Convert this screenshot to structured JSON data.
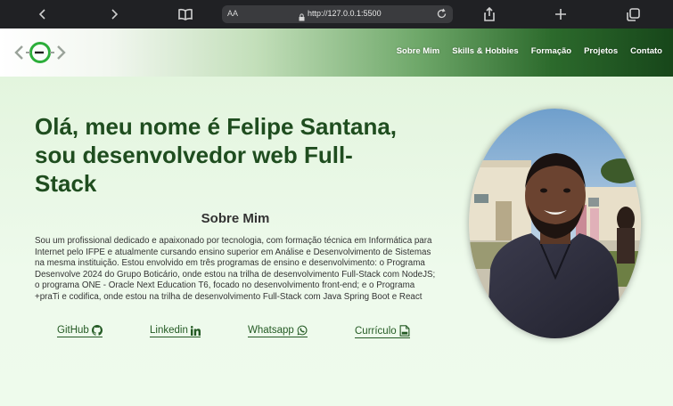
{
  "browser": {
    "text_size_label": "AA",
    "url": "http://127.0.0.1:5500"
  },
  "nav": {
    "items": [
      {
        "label": "Sobre Mim"
      },
      {
        "label": "Skills & Hobbies"
      },
      {
        "label": "Formação"
      },
      {
        "label": "Projetos"
      },
      {
        "label": "Contato"
      }
    ]
  },
  "hero": {
    "headline_line1": "Olá, meu nome é Felipe Santana,",
    "headline_line2": "sou desenvolvedor web Full-",
    "headline_line3": "Stack"
  },
  "about": {
    "title": "Sobre Mim",
    "text": "Sou um profissional dedicado e apaixonado por tecnologia, com formação técnica em Informática para Internet pelo IFPE e atualmente cursando ensino superior em Análise e Desenvolvimento de Sistemas na mesma instituição. Estou envolvido em três programas de ensino e desenvolvimento: o Programa Desenvolve 2024 do Grupo Boticário, onde estou na trilha de desenvolvimento Full-Stack com NodeJS; o programa ONE - Oracle Next Education T6, focado no desenvolvimento front-end; e o Programa +praTi e codifica, onde estou na trilha de desenvolvimento Full-Stack com Java Spring Boot e React"
  },
  "links": {
    "github": "GitHub",
    "linkedin": "Linkedin",
    "whatsapp": "Whatsapp",
    "curriculo": "Currículo"
  },
  "colors": {
    "brand_green": "#1f4d1f",
    "link_green": "#245a24",
    "logo_green": "#2cae3a"
  }
}
